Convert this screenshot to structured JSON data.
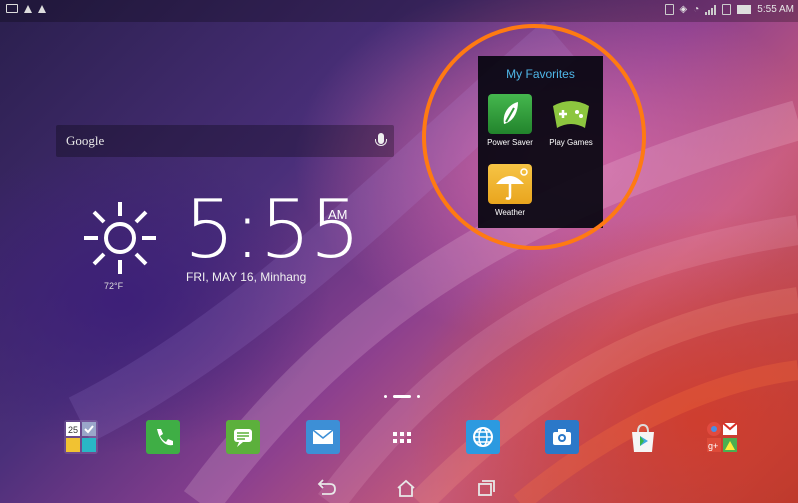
{
  "google_bar": {
    "label": "Google"
  },
  "clock_widget": {
    "time": "5:55",
    "ampm": "AM",
    "date": "FRI, MAY 16, Minhang",
    "temperature": "72°F"
  },
  "status_bar": {
    "time": "5:55 AM"
  },
  "favorites": {
    "title": "My Favorites",
    "apps": [
      {
        "label": "Power Saver",
        "icon": "leaf-icon",
        "color": "#2f9a3a"
      },
      {
        "label": "Play Games",
        "icon": "gamepad-icon",
        "color": "#8dc63f"
      },
      {
        "label": "Weather",
        "icon": "umbrella-icon",
        "color": "#f2b32f"
      }
    ]
  },
  "highlight_color": "#ff7a12",
  "dock": [
    {
      "name": "calendar-contacts-folder",
      "icon": "folder-icon"
    },
    {
      "name": "phone",
      "icon": "phone-icon",
      "color": "#3fae45"
    },
    {
      "name": "messaging",
      "icon": "message-icon",
      "color": "#5cb03c"
    },
    {
      "name": "email",
      "icon": "email-icon",
      "color": "#3d8fd6"
    },
    {
      "name": "all-apps",
      "icon": "apps-grid-icon"
    },
    {
      "name": "browser",
      "icon": "globe-icon",
      "color": "#2c9ae0"
    },
    {
      "name": "camera",
      "icon": "camera-icon",
      "color": "#2b78c8"
    },
    {
      "name": "play-store",
      "icon": "play-store-icon"
    },
    {
      "name": "google-folder",
      "icon": "folder-icon"
    }
  ],
  "nav": [
    "back-icon",
    "home-icon",
    "recent-apps-icon"
  ]
}
